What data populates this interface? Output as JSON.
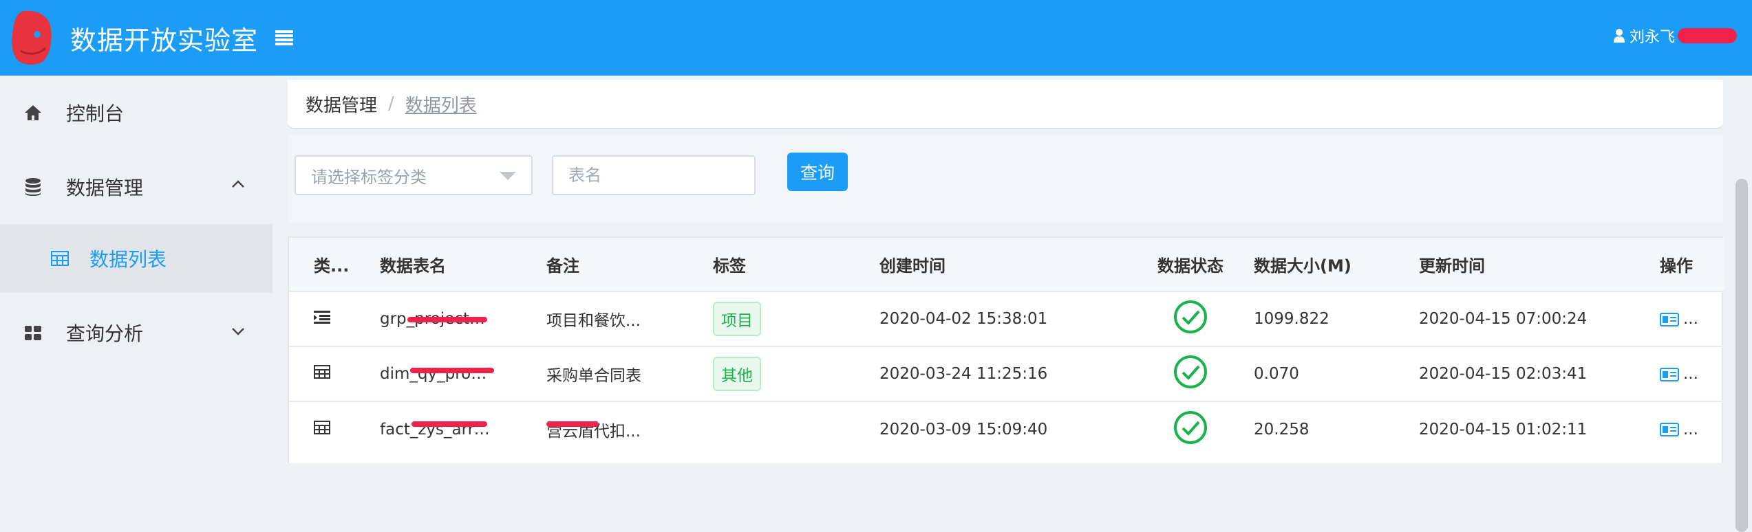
{
  "header": {
    "app_title": "数据开放实验室",
    "user_name": "刘永飞"
  },
  "sidebar": {
    "items": [
      {
        "label": "控制台",
        "icon": "home-icon"
      },
      {
        "label": "数据管理",
        "icon": "database-icon",
        "expanded": true,
        "children": [
          {
            "label": "数据列表",
            "icon": "table-icon",
            "active": true
          }
        ]
      },
      {
        "label": "查询分析",
        "icon": "grid-icon",
        "expanded": false
      }
    ]
  },
  "breadcrumb": {
    "root": "数据管理",
    "separator": "/",
    "current": "数据列表"
  },
  "filters": {
    "tag_select_placeholder": "请选择标签分类",
    "table_name_placeholder": "表名",
    "query_label": "查询"
  },
  "table": {
    "headers": [
      "类...",
      "数据表名",
      "备注",
      "标签",
      "创建时间",
      "数据状态",
      "数据大小(M)",
      "更新时间",
      "操作"
    ],
    "rows": [
      {
        "type_icon": "indent-icon",
        "name": "grp_project_...",
        "remark": "项目和餐饮...",
        "tag": "项目",
        "created": "2020-04-02 15:38:01",
        "status": "ok",
        "size": "1099.822",
        "updated": "2020-04-15 07:00:24",
        "action": "..."
      },
      {
        "type_icon": "table-icon",
        "name": "dim_qy_proj...",
        "remark": "采购单合同表",
        "tag": "其他",
        "created": "2020-03-24 11:25:16",
        "status": "ok",
        "size": "0.070",
        "updated": "2020-04-15 02:03:41",
        "action": "..."
      },
      {
        "type_icon": "table-icon",
        "name": "fact_zys_arre...",
        "remark": "营云盾代扣...",
        "tag": "",
        "created": "2020-03-09 15:09:40",
        "status": "ok",
        "size": "20.258",
        "updated": "2020-04-15 01:02:11",
        "action": "..."
      }
    ]
  },
  "colors": {
    "primary": "#1a9cf7",
    "success": "#1bb24e",
    "redaction": "#f0214b"
  }
}
